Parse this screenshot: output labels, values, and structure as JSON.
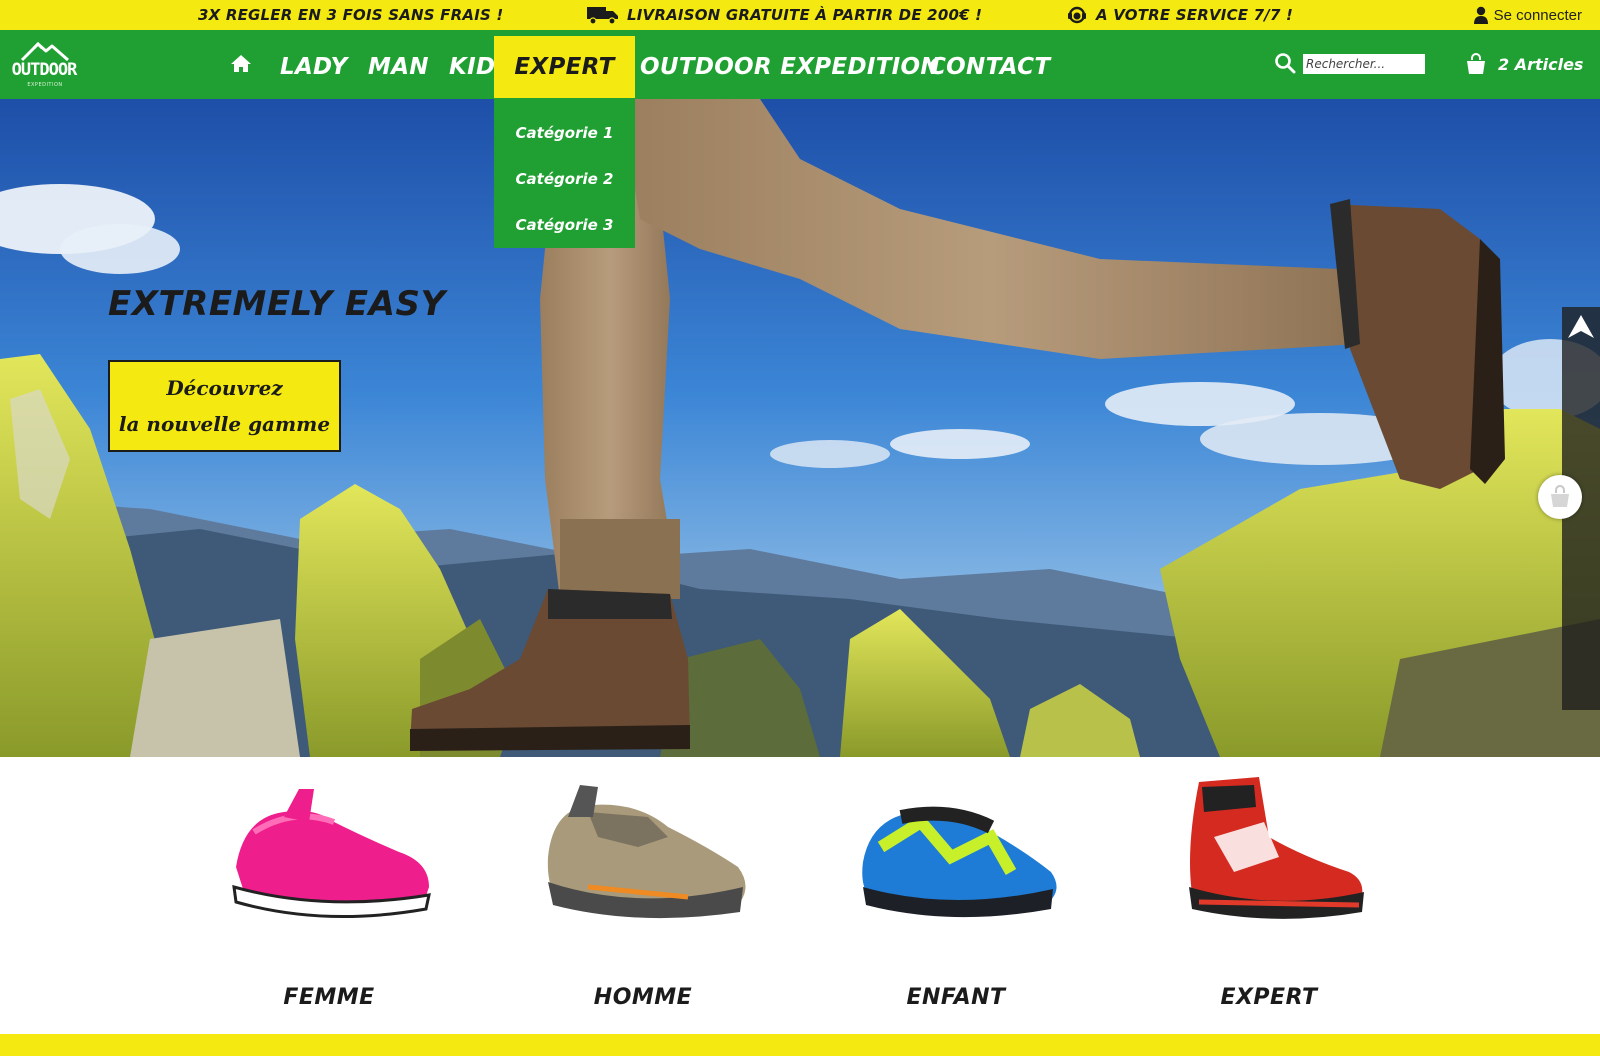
{
  "colors": {
    "brand_green": "#20a032",
    "brand_yellow": "#f4ea12",
    "text_dark": "#1b1b1b"
  },
  "promo": {
    "items": [
      {
        "icon": "none",
        "text": "3X  REGLER EN 3 FOIS SANS FRAIS !"
      },
      {
        "icon": "truck-icon",
        "text": "LIVRAISON GRATUITE À PARTIR DE 200€ !"
      },
      {
        "icon": "support-icon",
        "text": "A VOTRE SERVICE 7/7 !"
      }
    ],
    "login_label": "Se connecter"
  },
  "logo": {
    "text": "OUTDOOR",
    "sub": "EXPEDITION"
  },
  "nav": {
    "items": [
      {
        "label": "LADY"
      },
      {
        "label": "MAN"
      },
      {
        "label": "KID"
      },
      {
        "label": "EXPERT",
        "active": true
      },
      {
        "label": "OUTDOOR EXPEDITION"
      },
      {
        "label": "CONTACT"
      }
    ],
    "search_placeholder": "Rechercher...",
    "cart_label": "2 Articles"
  },
  "dropdown": {
    "items": [
      {
        "label": "Catégorie 1"
      },
      {
        "label": "Catégorie 2"
      },
      {
        "label": "Catégorie 3"
      }
    ]
  },
  "hero": {
    "title": "EXTREMELY EASY",
    "cta_line1": "Découvrez",
    "cta_line2": "la nouvelle gamme"
  },
  "categories": [
    {
      "label": "FEMME",
      "icon": "pink-sneaker-icon"
    },
    {
      "label": "HOMME",
      "icon": "hiking-shoe-icon"
    },
    {
      "label": "ENFANT",
      "icon": "kids-shoe-icon"
    },
    {
      "label": "EXPERT",
      "icon": "mountaineering-boot-icon"
    }
  ]
}
